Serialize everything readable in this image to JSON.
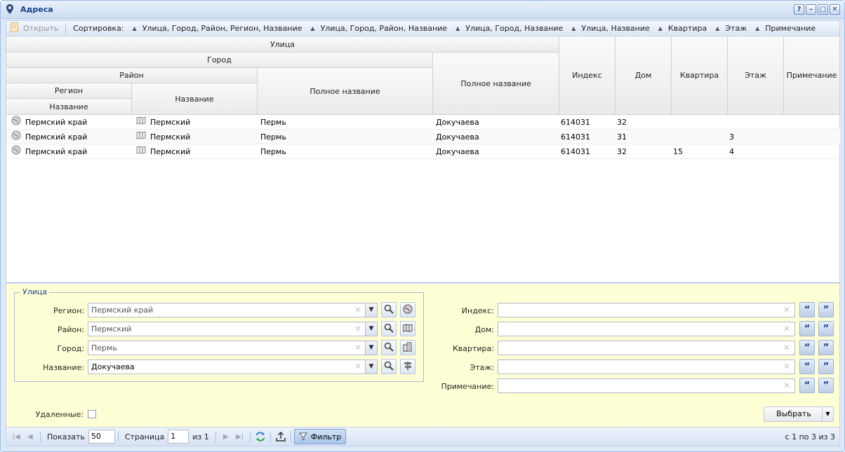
{
  "window": {
    "title": "Адреса"
  },
  "toolbar": {
    "open_label": "Открыть",
    "sort_label": "Сортировка:",
    "sort_options": [
      "Улица, Город, Район, Регион, Название",
      "Улица, Город, Район, Название",
      "Улица, Город, Название",
      "Улица, Название",
      "Квартира",
      "Этаж",
      "Примечание"
    ]
  },
  "grid": {
    "headers": {
      "street": "Улица",
      "city": "Город",
      "district": "Район",
      "region": "Регион",
      "region_name": "Название",
      "district_name": "Название",
      "city_full_name": "Полное название",
      "street_full_name": "Полное название",
      "index": "Индекс",
      "house": "Дом",
      "apartment": "Квартира",
      "floor": "Этаж",
      "note": "Примечание"
    },
    "rows": [
      {
        "region": "Пермский край",
        "district": "Пермский",
        "city": "Пермь",
        "street": "Докучаева",
        "index": "614031",
        "house": "32",
        "apartment": "",
        "floor": "",
        "note": ""
      },
      {
        "region": "Пермский край",
        "district": "Пермский",
        "city": "Пермь",
        "street": "Докучаева",
        "index": "614031",
        "house": "31",
        "apartment": "",
        "floor": "3",
        "note": ""
      },
      {
        "region": "Пермский край",
        "district": "Пермский",
        "city": "Пермь",
        "street": "Докучаева",
        "index": "614031",
        "house": "32",
        "apartment": "15",
        "floor": "4",
        "note": ""
      }
    ]
  },
  "filter": {
    "street_group_label": "Улица",
    "region_label": "Регион:",
    "region_value": "Пермский край",
    "district_label": "Район:",
    "district_value": "Пермский",
    "city_label": "Город:",
    "city_value": "Пермь",
    "name_label": "Название:",
    "name_value": "Докучаева",
    "index_label": "Индекс:",
    "house_label": "Дом:",
    "apartment_label": "Квартира:",
    "floor_label": "Этаж:",
    "note_label": "Примечание:",
    "deleted_label": "Удаленные:",
    "select_label": "Выбрать"
  },
  "pager": {
    "show_label": "Показать",
    "page_size": "50",
    "page_label": "Страница",
    "page_value": "1",
    "of_label": "из 1",
    "filter_label": "Фильтр",
    "status": "с 1 по 3 из 3"
  }
}
